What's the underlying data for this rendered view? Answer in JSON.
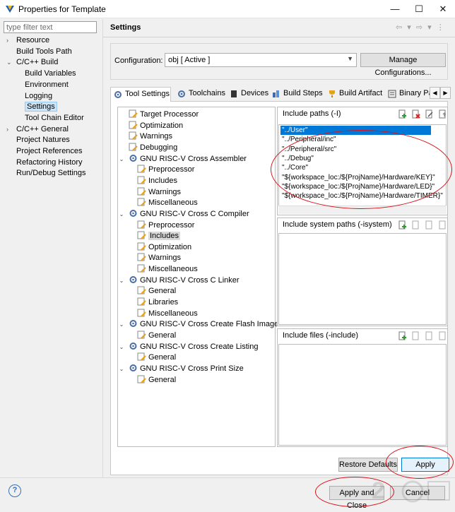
{
  "window": {
    "title": "Properties for Template",
    "minimize": "—",
    "maximize": "☐",
    "close": "✕"
  },
  "filter": {
    "placeholder": "type filter text"
  },
  "nav": {
    "items": [
      {
        "label": "Resource",
        "arrow": "›",
        "indent": 0
      },
      {
        "label": "Build Tools Path",
        "arrow": "",
        "indent": 0
      },
      {
        "label": "C/C++ Build",
        "arrow": "⌄",
        "indent": 0
      },
      {
        "label": "Build Variables",
        "arrow": "",
        "indent": 1
      },
      {
        "label": "Environment",
        "arrow": "",
        "indent": 1
      },
      {
        "label": "Logging",
        "arrow": "",
        "indent": 1
      },
      {
        "label": "Settings",
        "arrow": "",
        "indent": 1,
        "selected": true
      },
      {
        "label": "Tool Chain Editor",
        "arrow": "",
        "indent": 1
      },
      {
        "label": "C/C++ General",
        "arrow": "›",
        "indent": 0
      },
      {
        "label": "Project Natures",
        "arrow": "",
        "indent": 0
      },
      {
        "label": "Project References",
        "arrow": "",
        "indent": 0
      },
      {
        "label": "Refactoring History",
        "arrow": "",
        "indent": 0
      },
      {
        "label": "Run/Debug Settings",
        "arrow": "",
        "indent": 0
      }
    ]
  },
  "header": {
    "title": "Settings"
  },
  "config": {
    "label": "Configuration:",
    "value": "obj  [ Active ]",
    "manage_label": "Manage Configurations..."
  },
  "tabs": [
    {
      "label": "Tool Settings",
      "icon": "tool-settings-icon"
    },
    {
      "label": "Toolchains",
      "icon": "toolchains-icon"
    },
    {
      "label": "Devices",
      "icon": "devices-icon"
    },
    {
      "label": "Build Steps",
      "icon": "build-steps-icon"
    },
    {
      "label": "Build Artifact",
      "icon": "build-artifact-icon"
    },
    {
      "label": "Binary Pa",
      "icon": "binary-parsers-icon"
    }
  ],
  "tool_tree": [
    {
      "label": "Target Processor",
      "level": 0,
      "exp": ""
    },
    {
      "label": "Optimization",
      "level": 0,
      "exp": ""
    },
    {
      "label": "Warnings",
      "level": 0,
      "exp": ""
    },
    {
      "label": "Debugging",
      "level": 0,
      "exp": ""
    },
    {
      "label": "GNU RISC-V Cross Assembler",
      "level": 0,
      "exp": "⌄"
    },
    {
      "label": "Preprocessor",
      "level": 1,
      "exp": ""
    },
    {
      "label": "Includes",
      "level": 1,
      "exp": ""
    },
    {
      "label": "Warnings",
      "level": 1,
      "exp": ""
    },
    {
      "label": "Miscellaneous",
      "level": 1,
      "exp": ""
    },
    {
      "label": "GNU RISC-V Cross C Compiler",
      "level": 0,
      "exp": "⌄"
    },
    {
      "label": "Preprocessor",
      "level": 1,
      "exp": ""
    },
    {
      "label": "Includes",
      "level": 1,
      "exp": "",
      "selected": true
    },
    {
      "label": "Optimization",
      "level": 1,
      "exp": ""
    },
    {
      "label": "Warnings",
      "level": 1,
      "exp": ""
    },
    {
      "label": "Miscellaneous",
      "level": 1,
      "exp": ""
    },
    {
      "label": "GNU RISC-V Cross C Linker",
      "level": 0,
      "exp": "⌄"
    },
    {
      "label": "General",
      "level": 1,
      "exp": ""
    },
    {
      "label": "Libraries",
      "level": 1,
      "exp": ""
    },
    {
      "label": "Miscellaneous",
      "level": 1,
      "exp": ""
    },
    {
      "label": "GNU RISC-V Cross Create Flash Image",
      "level": 0,
      "exp": "⌄"
    },
    {
      "label": "General",
      "level": 1,
      "exp": ""
    },
    {
      "label": "GNU RISC-V Cross Create Listing",
      "level": 0,
      "exp": "⌄"
    },
    {
      "label": "General",
      "level": 1,
      "exp": ""
    },
    {
      "label": "GNU RISC-V Cross Print Size",
      "level": 0,
      "exp": "⌄"
    },
    {
      "label": "General",
      "level": 1,
      "exp": ""
    }
  ],
  "include_paths": {
    "title": "Include paths (-I)",
    "items": [
      "\"../User\"",
      "\"../Peripheral/inc\"",
      "\"../Peripheral/src\"",
      "\"../Debug\"",
      "\"../Core\"",
      "\"${workspace_loc:/${ProjName}/Hardware/KEY}\"",
      "\"${workspace_loc:/${ProjName}/Hardware/LED}\"",
      "\"${workspace_loc:/${ProjName}/Hardware/TIMER}\""
    ]
  },
  "include_system": {
    "title": "Include system paths (-isystem)"
  },
  "include_files": {
    "title": "Include files (-include)"
  },
  "buttons": {
    "restore": "Restore Defaults",
    "apply": "Apply",
    "apply_close": "Apply and Close",
    "cancel": "Cancel"
  },
  "help": {
    "glyph": "?"
  },
  "header_nav": {
    "glyphs": "⇦ ▾ ⇨ ▾ ⋮"
  },
  "colors": {
    "selection": "#0078d7",
    "annotation": "#d9131a",
    "accent": "#0078d7"
  }
}
